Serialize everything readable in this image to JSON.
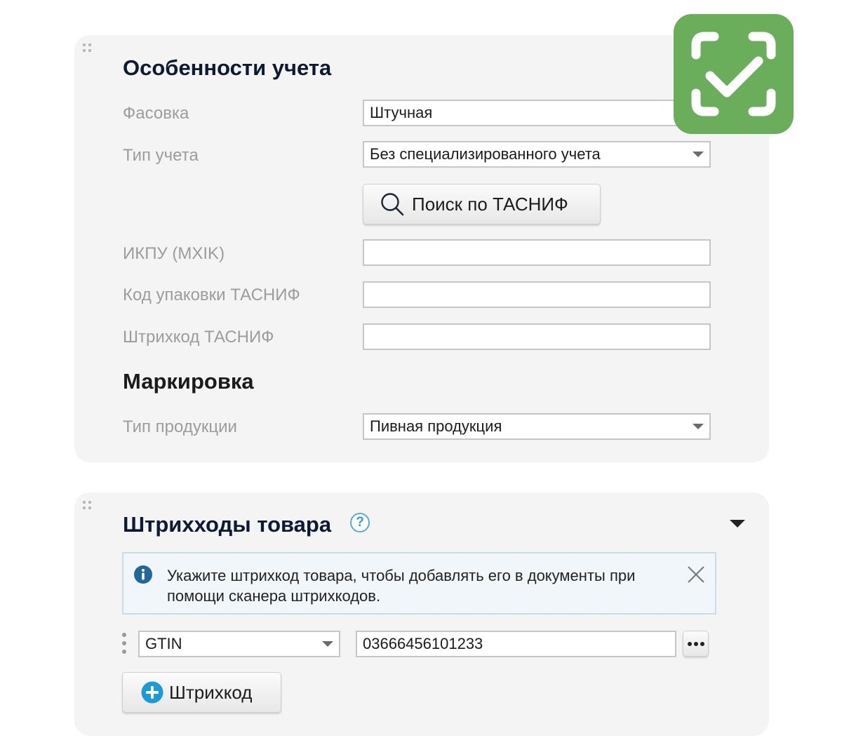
{
  "accounting": {
    "title": "Особенности учета",
    "packaging": {
      "label": "Фасовка",
      "value": "Штучная"
    },
    "accounting_type": {
      "label": "Тип учета",
      "value": "Без специализированного учета"
    },
    "search_button": "Поиск по ТАСНИФ",
    "ikpu": {
      "label": "ИКПУ (MXIK)",
      "value": ""
    },
    "pack_code": {
      "label": "Код упаковки ТАСНИФ",
      "value": ""
    },
    "barcode_tasnif": {
      "label": "Штрихкод ТАСНИФ",
      "value": ""
    }
  },
  "marking": {
    "title": "Маркировка",
    "product_type": {
      "label": "Тип продукции",
      "value": "Пивная продукция"
    }
  },
  "barcodes": {
    "title": "Штрихходы товара",
    "help_glyph": "?",
    "info": "Укажите штрихкод товара, чтобы добавлять его в  документы при помощи сканера штрихкодов.",
    "rows": [
      {
        "type": "GTIN",
        "value": "03666456101233"
      }
    ],
    "add_button": "Штрихкод"
  },
  "icons": {
    "scan": "barcode-scan-check-icon",
    "search": "search-icon",
    "info": "info-icon",
    "close": "close-icon",
    "more": "more-dots-icon",
    "add": "plus-circle-icon"
  },
  "colors": {
    "scan_badge": "#6aad5b",
    "accent_blue": "#1a9ad8",
    "info_icon": "#23679a",
    "title_navy": "#0c1a33"
  }
}
